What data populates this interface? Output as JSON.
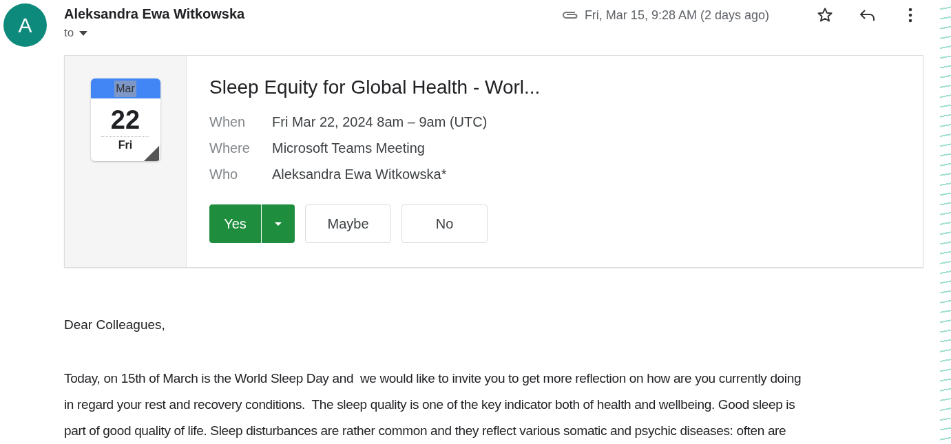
{
  "sender": {
    "avatar_letter": "A",
    "name": "Aleksandra Ewa Witkowska",
    "recipient_label": "to"
  },
  "header": {
    "date": "Fri, Mar 15, 9:28 AM (2 days ago)",
    "starred": false
  },
  "invite": {
    "calendar": {
      "month": "Mar",
      "day": "22",
      "weekday": "Fri"
    },
    "title": "Sleep Equity for Global Health - Worl...",
    "details": [
      {
        "label": "When",
        "value": "Fri Mar 22, 2024 8am – 9am (UTC)"
      },
      {
        "label": "Where",
        "value": "Microsoft Teams Meeting"
      },
      {
        "label": "Who",
        "value": "Aleksandra Ewa Witkowska*"
      }
    ],
    "rsvp": [
      {
        "label": "Yes",
        "selected": true
      },
      {
        "label": "Maybe",
        "selected": false
      },
      {
        "label": "No",
        "selected": false
      }
    ]
  },
  "body": {
    "greeting": "Dear Colleagues,",
    "paragraph_lines": [
      "Today, on 15th of March is the World Sleep Day and  we would like to invite you to get more reflection on how are you currently doing",
      "in regard your rest and recovery conditions.  The sleep quality is one of the key indicator both of health and wellbeing. Good sleep is",
      "part of good quality of life. Sleep disturbances are rather common and they reflect various somatic and psychic diseases: often are"
    ]
  }
}
